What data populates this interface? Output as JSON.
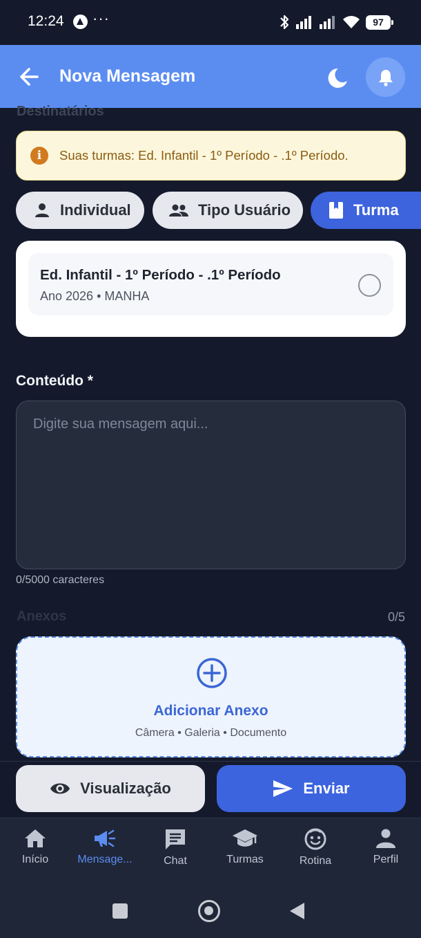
{
  "status_bar": {
    "time": "12:24",
    "battery": "97"
  },
  "app_bar": {
    "title": "Nova Mensagem"
  },
  "recipients": {
    "heading": "Destinatários",
    "info": "Suas turmas: Ed. Infantil - 1º Período - .1º Período.",
    "tabs": [
      {
        "label": "Individual",
        "icon": "person-icon"
      },
      {
        "label": "Tipo Usuário",
        "icon": "group-icon"
      },
      {
        "label": "Turma",
        "icon": "book-icon",
        "selected": true
      }
    ],
    "class_item": {
      "name": "Ed. Infantil - 1º Período - .1º Período",
      "details": "Ano 2026 • MANHA"
    }
  },
  "content": {
    "label": "Conteúdo *",
    "placeholder": "Digite sua mensagem aqui...",
    "char_count": "0/5000 caracteres"
  },
  "attachments": {
    "label": "Anexos",
    "count": "0/5",
    "add_label": "Adicionar Anexo",
    "sources": "Câmera • Galeria • Documento"
  },
  "actions": {
    "preview_label": "Visualização",
    "send_label": "Enviar"
  },
  "bottom_nav": [
    {
      "label": "Início",
      "icon": "home-icon"
    },
    {
      "label": "Mensage...",
      "icon": "megaphone-icon",
      "active": true
    },
    {
      "label": "Chat",
      "icon": "chat-icon"
    },
    {
      "label": "Turmas",
      "icon": "graduation-cap-icon"
    },
    {
      "label": "Rotina",
      "icon": "face-icon"
    },
    {
      "label": "Perfil",
      "icon": "person-icon"
    }
  ],
  "colors": {
    "primary": "#3c64df",
    "app_bar": "#5b8df1",
    "background": "#141a2b",
    "warning_bg": "#fcf7dc",
    "warning_icon": "#d17a1f"
  }
}
